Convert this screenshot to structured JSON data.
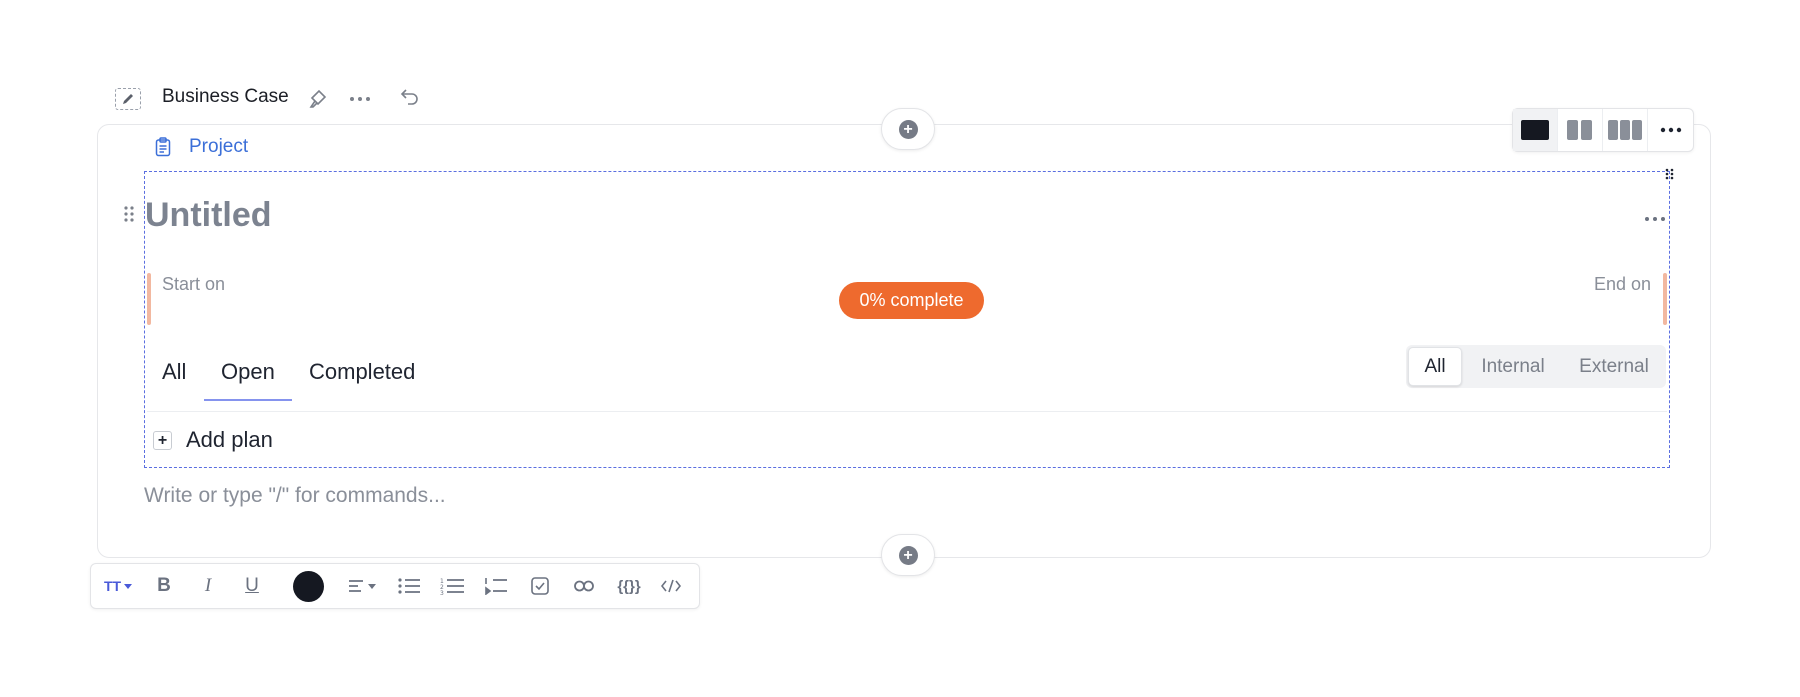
{
  "header": {
    "title": "Business Case",
    "icons": [
      "edit-icon",
      "brush-icon",
      "more-horizontal-icon",
      "undo-icon"
    ]
  },
  "section": {
    "type_label": "Project",
    "layout_options": [
      "one-column",
      "two-column",
      "three-column",
      "more"
    ]
  },
  "plan": {
    "title": "Untitled",
    "start_label": "Start on",
    "end_label": "End on",
    "progress_text": "0% complete",
    "tabs": [
      {
        "label": "All",
        "active": false
      },
      {
        "label": "Open",
        "active": true
      },
      {
        "label": "Completed",
        "active": false
      }
    ],
    "filter": {
      "options": [
        "All",
        "Internal",
        "External"
      ],
      "selected": "All"
    },
    "add_label": "Add plan"
  },
  "editor": {
    "placeholder": "Write or type \"/\" for commands..."
  },
  "toolbar": {
    "text_size_label": "TT",
    "bold_label": "B",
    "italic_label": "I",
    "underline_label": "U",
    "variables_label": "{{}}",
    "text_color": "#151821"
  },
  "colors": {
    "accent": "#3b6fd8",
    "progress": "#ee6a2e",
    "selection": "#5a6ee0",
    "date_bar": "#f2b8a0"
  }
}
